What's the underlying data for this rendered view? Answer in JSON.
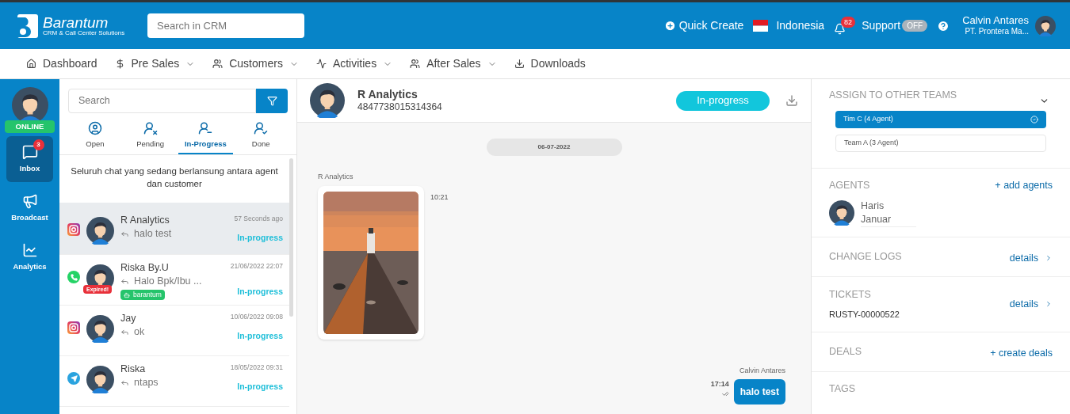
{
  "header": {
    "logo": {
      "name": "Barantum",
      "tagline": "CRM & Call Center Solutions"
    },
    "search": {
      "placeholder": "Search in CRM"
    },
    "quick_create": "Quick Create",
    "language": "Indonesia",
    "notifications": "82",
    "support": {
      "label": "Support",
      "toggle": "OFF",
      "on": false
    },
    "user": {
      "name": "Calvin Antares",
      "company": "PT. Prontera Ma..."
    }
  },
  "nav": [
    {
      "label": "Dashboard",
      "dropdown": false
    },
    {
      "label": "Pre Sales",
      "dropdown": true
    },
    {
      "label": "Customers",
      "dropdown": true
    },
    {
      "label": "Activities",
      "dropdown": true
    },
    {
      "label": "After Sales",
      "dropdown": true
    },
    {
      "label": "Downloads",
      "dropdown": false
    }
  ],
  "rail": {
    "status": "ONLINE",
    "items": [
      {
        "label": "Inbox",
        "badge": "3",
        "selected": true
      },
      {
        "label": "Broadcast",
        "selected": false
      },
      {
        "label": "Analytics",
        "selected": false
      }
    ]
  },
  "chat_list": {
    "search": {
      "placeholder": "Search"
    },
    "tabs": [
      {
        "label": "Open",
        "selected": false
      },
      {
        "label": "Pending",
        "selected": false
      },
      {
        "label": "In-Progress",
        "selected": true
      },
      {
        "label": "Done",
        "selected": false
      }
    ],
    "description": "Seluruh chat yang sedang berlansung antara agent dan customer",
    "chats": [
      {
        "kind": "instagram",
        "name": "R Analytics",
        "preview": "halo test",
        "time": "57 Seconds ago",
        "status": "In-progress",
        "selected": true
      },
      {
        "kind": "whatsapp",
        "name": "Riska By.U",
        "preview": "Halo Bpk/Ibu ...",
        "time": "21/06/2022 22:07",
        "status": "In-progress",
        "selected": false,
        "badge": "Expired!",
        "tag": "barantum"
      },
      {
        "kind": "instagram",
        "name": "Jay",
        "preview": "ok",
        "time": "10/06/2022 09:08",
        "status": "In-progress",
        "selected": false
      },
      {
        "kind": "telegram",
        "name": "Riska",
        "preview": "ntaps",
        "time": "18/05/2022 09:31",
        "status": "In-progress",
        "selected": false
      }
    ]
  },
  "conversation": {
    "contact": {
      "name": "R Analytics",
      "id": "4847738015314364"
    },
    "status": "In-progress",
    "date": "06-07-2022",
    "messages": [
      {
        "sender": "R Analytics",
        "time": "10:21"
      },
      {
        "kind": "outgoing",
        "sender": "Calvin Antares",
        "text": "halo test",
        "time": "17:14"
      }
    ]
  },
  "details": {
    "teams": {
      "title": "ASSIGN TO OTHER TEAMS",
      "items": [
        {
          "label": "Tim C (4 Agent)",
          "selected": true
        },
        {
          "label": "Team A (3 Agent)",
          "selected": false
        }
      ]
    },
    "agents": {
      "title": "AGENTS",
      "action": "+ add agents",
      "items": [
        {
          "first": "Haris",
          "last": "Januar"
        }
      ]
    },
    "change_logs": {
      "title": "CHANGE LOGS",
      "action": "details"
    },
    "tickets": {
      "title": "TICKETS",
      "action": "details",
      "value": "RUSTY-00000522"
    },
    "deals": {
      "title": "DEALS",
      "action": "+ create deals"
    },
    "tags": {
      "title": "TAGS"
    }
  }
}
